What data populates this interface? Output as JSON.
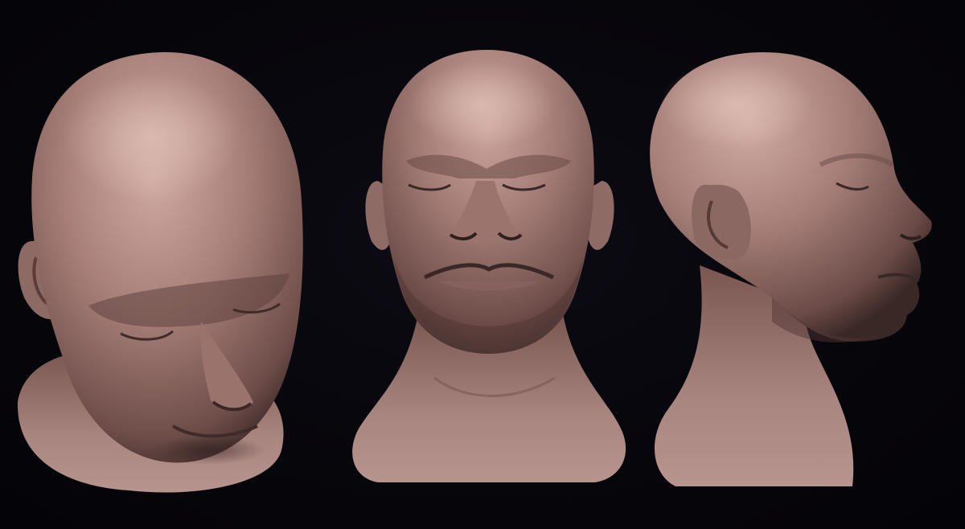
{
  "scene": {
    "background_color": "#06050b",
    "skin_highlight_color": "#c9a49c",
    "skin_mid_color": "#9c756f",
    "skin_shadow_color": "#4a3331"
  },
  "views": [
    {
      "view": "top-down",
      "icon": "head-sculpt-top-view"
    },
    {
      "view": "front",
      "icon": "head-sculpt-front-view"
    },
    {
      "view": "profile-right",
      "icon": "head-sculpt-side-view"
    }
  ]
}
